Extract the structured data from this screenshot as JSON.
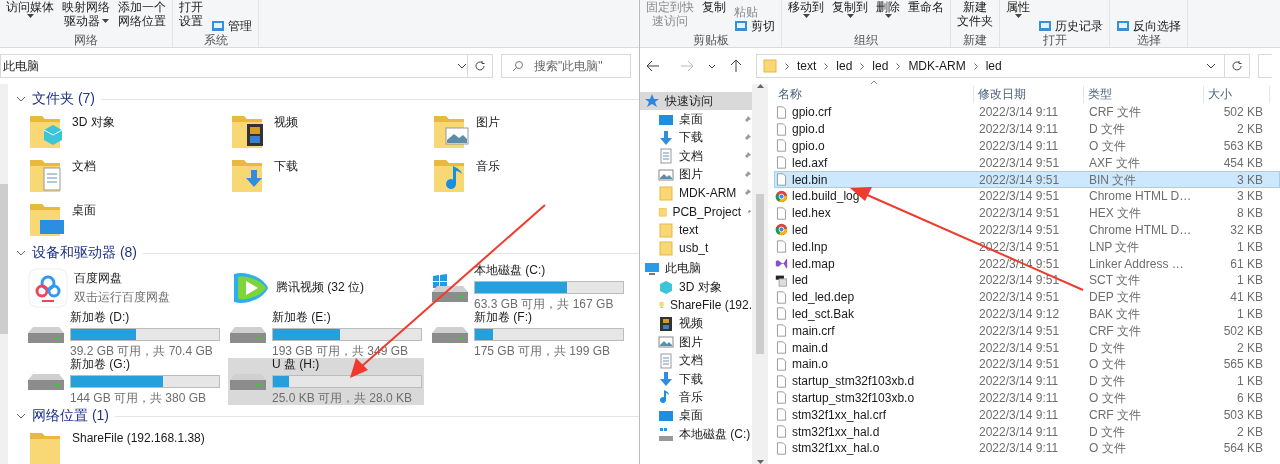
{
  "left_window": {
    "ribbon": [
      {
        "label": "网络",
        "columns": [
          [
            {
              "kind": "large",
              "lines": [
                "访问媒体"
              ],
              "dropdown": true
            }
          ],
          [
            {
              "kind": "large",
              "lines": [
                "映射网络",
                "驱动器"
              ],
              "dropdown": true
            }
          ],
          [
            {
              "kind": "large",
              "lines": [
                "添加一个",
                "网络位置"
              ],
              "dropdown": false
            }
          ]
        ]
      },
      {
        "label": "系统",
        "columns": [
          [
            {
              "kind": "large",
              "lines": [
                "打开",
                "设置"
              ],
              "dropdown": false
            }
          ],
          [
            {
              "kind": "small",
              "lines": [
                "管理"
              ],
              "dropdown": false
            }
          ]
        ]
      }
    ],
    "address": {
      "path": "此电脑"
    },
    "search": {
      "placeholder": "搜索\"此电脑\""
    },
    "sections": [
      {
        "title": "文件夹 (7)",
        "items": [
          {
            "kind": "cube",
            "name": "3D 对象"
          },
          {
            "kind": "video",
            "name": "视频"
          },
          {
            "kind": "picture",
            "name": "图片"
          },
          {
            "kind": "document",
            "name": "文档"
          },
          {
            "kind": "download",
            "name": "下载"
          },
          {
            "kind": "music",
            "name": "音乐"
          },
          {
            "kind": "desktop",
            "name": "桌面"
          }
        ]
      },
      {
        "title": "设备和驱动器 (8)",
        "items": [
          {
            "kind": "app-cloud",
            "name": "百度网盘",
            "detail": "双击运行百度网盘",
            "selected": false
          },
          {
            "kind": "app-play",
            "name": "腾讯视频 (32 位)",
            "selected": false
          },
          {
            "kind": "system-drive",
            "name": "本地磁盘 (C:)",
            "level": 0.62,
            "detail": "63.3 GB 可用，共 167 GB",
            "selected": false
          },
          {
            "kind": "drive",
            "name": "新加卷 (D:)",
            "level": 0.44,
            "detail": "39.2 GB 可用，共 70.4 GB",
            "selected": false
          },
          {
            "kind": "drive",
            "name": "新加卷 (E:)",
            "level": 0.45,
            "detail": "193 GB 可用，共 349 GB",
            "selected": false
          },
          {
            "kind": "drive",
            "name": "新加卷 (F:)",
            "level": 0.12,
            "detail": "175 GB 可用，共 199 GB",
            "selected": false
          },
          {
            "kind": "drive",
            "name": "新加卷 (G:)",
            "level": 0.62,
            "detail": "144 GB 可用，共 380 GB",
            "selected": false
          },
          {
            "kind": "drive",
            "name": "U 盘 (H:)",
            "level": 0.11,
            "detail": "25.0 KB 可用，共 28.0 KB",
            "selected": true
          }
        ]
      },
      {
        "title": "网络位置 (1)",
        "items": [
          {
            "kind": "network-folder",
            "name": "ShareFile (192.168.1.38)"
          }
        ]
      }
    ]
  },
  "right_window": {
    "ribbon": [
      {
        "label": "剪贴板",
        "columns": [
          [
            {
              "kind": "large",
              "lines": [
                "固定到快",
                "速访问"
              ],
              "dropdown": false,
              "disabled": true
            }
          ],
          [
            {
              "kind": "large",
              "lines": [
                "复制"
              ],
              "dropdown": false,
              "disabled": false
            }
          ],
          [
            {
              "kind": "text",
              "lines": [
                "粘贴"
              ],
              "dropdown": false,
              "disabled": true
            },
            {
              "kind": "small",
              "lines": [
                "剪切"
              ],
              "dropdown": false,
              "disabled": false
            }
          ]
        ]
      },
      {
        "label": "组织",
        "columns": [
          [
            {
              "kind": "large",
              "lines": [
                "移动到"
              ],
              "dropdown": true,
              "disabled": false
            }
          ],
          [
            {
              "kind": "large",
              "lines": [
                "复制到"
              ],
              "dropdown": true,
              "disabled": false
            }
          ],
          [
            {
              "kind": "large",
              "lines": [
                "删除"
              ],
              "dropdown": true,
              "disabled": false
            }
          ],
          [
            {
              "kind": "large",
              "lines": [
                "重命名"
              ],
              "dropdown": false,
              "disabled": false
            }
          ]
        ]
      },
      {
        "label": "新建",
        "columns": [
          [
            {
              "kind": "large",
              "lines": [
                "新建",
                "文件夹"
              ],
              "dropdown": false,
              "disabled": false
            }
          ]
        ]
      },
      {
        "label": "打开",
        "columns": [
          [
            {
              "kind": "large",
              "lines": [
                "属性"
              ],
              "dropdown": true,
              "disabled": false
            }
          ],
          [
            {
              "kind": "small",
              "lines": [
                "历史记录"
              ],
              "dropdown": false,
              "disabled": false
            }
          ]
        ]
      },
      {
        "label": "选择",
        "columns": [
          [
            {
              "kind": "small",
              "lines": [
                "反向选择"
              ],
              "dropdown": false,
              "disabled": false
            }
          ]
        ]
      }
    ],
    "breadcrumbs": [
      "text",
      "led",
      "led",
      "MDK-ARM",
      "led"
    ],
    "nav": [
      {
        "kind": "star",
        "label": "快速访问",
        "selected": true,
        "children": [
          {
            "kind": "desktop",
            "label": "桌面",
            "pinned": true,
            "selected": false
          },
          {
            "kind": "download",
            "label": "下载",
            "pinned": true,
            "selected": false
          },
          {
            "kind": "document",
            "label": "文档",
            "pinned": true,
            "selected": false
          },
          {
            "kind": "picture",
            "label": "图片",
            "pinned": true,
            "selected": false
          },
          {
            "kind": "folder",
            "label": "MDK-ARM",
            "pinned": true,
            "selected": false
          },
          {
            "kind": "folder",
            "label": "PCB_Project",
            "pinned": true,
            "selected": false
          },
          {
            "kind": "folder",
            "label": "text",
            "pinned": false,
            "selected": false
          },
          {
            "kind": "folder",
            "label": "usb_t",
            "pinned": false,
            "selected": false
          }
        ]
      },
      {
        "kind": "pc",
        "label": "此电脑",
        "selected": false,
        "children": [
          {
            "kind": "cube",
            "label": "3D 对象",
            "selected": false
          },
          {
            "kind": "network-folder",
            "label": "ShareFile (192.",
            "selected": false
          },
          {
            "kind": "video",
            "label": "视频",
            "selected": false
          },
          {
            "kind": "picture",
            "label": "图片",
            "selected": false
          },
          {
            "kind": "document",
            "label": "文档",
            "selected": false
          },
          {
            "kind": "download",
            "label": "下载",
            "selected": false
          },
          {
            "kind": "music",
            "label": "音乐",
            "selected": false
          },
          {
            "kind": "desktop",
            "label": "桌面",
            "selected": false
          },
          {
            "kind": "system-drive",
            "label": "本地磁盘 (C:)",
            "selected": false
          }
        ]
      }
    ],
    "columns": [
      "名称",
      "修改日期",
      "类型",
      "大小"
    ],
    "files": [
      {
        "kind": "file",
        "name": "gpio.crf",
        "date": "2022/3/14 9:11",
        "type": "CRF 文件",
        "size": "502 KB",
        "selected": false
      },
      {
        "kind": "file",
        "name": "gpio.d",
        "date": "2022/3/14 9:11",
        "type": "D 文件",
        "size": "2 KB",
        "selected": false
      },
      {
        "kind": "file",
        "name": "gpio.o",
        "date": "2022/3/14 9:11",
        "type": "O 文件",
        "size": "563 KB",
        "selected": false
      },
      {
        "kind": "file",
        "name": "led.axf",
        "date": "2022/3/14 9:51",
        "type": "AXF 文件",
        "size": "454 KB",
        "selected": false
      },
      {
        "kind": "file",
        "name": "led.bin",
        "date": "2022/3/14 9:51",
        "type": "BIN 文件",
        "size": "3 KB",
        "selected": true
      },
      {
        "kind": "browser",
        "name": "led.build_log",
        "date": "2022/3/14 9:51",
        "type": "Chrome HTML D…",
        "size": "3 KB",
        "selected": false
      },
      {
        "kind": "file",
        "name": "led.hex",
        "date": "2022/3/14 9:51",
        "type": "HEX 文件",
        "size": "8 KB",
        "selected": false
      },
      {
        "kind": "browser",
        "name": "led",
        "date": "2022/3/14 9:51",
        "type": "Chrome HTML D…",
        "size": "32 KB",
        "selected": false
      },
      {
        "kind": "file",
        "name": "led.lnp",
        "date": "2022/3/14 9:51",
        "type": "LNP 文件",
        "size": "1 KB",
        "selected": false
      },
      {
        "kind": "studio",
        "name": "led.map",
        "date": "2022/3/14 9:51",
        "type": "Linker Address …",
        "size": "61 KB",
        "selected": false
      },
      {
        "kind": "script",
        "name": "led",
        "date": "2022/3/14 9:51",
        "type": "SCT 文件",
        "size": "1 KB",
        "selected": false
      },
      {
        "kind": "file",
        "name": "led_led.dep",
        "date": "2022/3/14 9:51",
        "type": "DEP 文件",
        "size": "41 KB",
        "selected": false
      },
      {
        "kind": "file",
        "name": "led_sct.Bak",
        "date": "2022/3/14 9:12",
        "type": "BAK 文件",
        "size": "1 KB",
        "selected": false
      },
      {
        "kind": "file",
        "name": "main.crf",
        "date": "2022/3/14 9:51",
        "type": "CRF 文件",
        "size": "502 KB",
        "selected": false
      },
      {
        "kind": "file",
        "name": "main.d",
        "date": "2022/3/14 9:51",
        "type": "D 文件",
        "size": "2 KB",
        "selected": false
      },
      {
        "kind": "file",
        "name": "main.o",
        "date": "2022/3/14 9:51",
        "type": "O 文件",
        "size": "565 KB",
        "selected": false
      },
      {
        "kind": "file",
        "name": "startup_stm32f103xb.d",
        "date": "2022/3/14 9:11",
        "type": "D 文件",
        "size": "1 KB",
        "selected": false
      },
      {
        "kind": "file",
        "name": "startup_stm32f103xb.o",
        "date": "2022/3/14 9:11",
        "type": "O 文件",
        "size": "6 KB",
        "selected": false
      },
      {
        "kind": "file",
        "name": "stm32f1xx_hal.crf",
        "date": "2022/3/14 9:11",
        "type": "CRF 文件",
        "size": "503 KB",
        "selected": false
      },
      {
        "kind": "file",
        "name": "stm32f1xx_hal.d",
        "date": "2022/3/14 9:11",
        "type": "D 文件",
        "size": "2 KB",
        "selected": false
      },
      {
        "kind": "file",
        "name": "stm32f1xx_hal.o",
        "date": "2022/3/14 9:11",
        "type": "O 文件",
        "size": "564 KB",
        "selected": false
      }
    ]
  }
}
